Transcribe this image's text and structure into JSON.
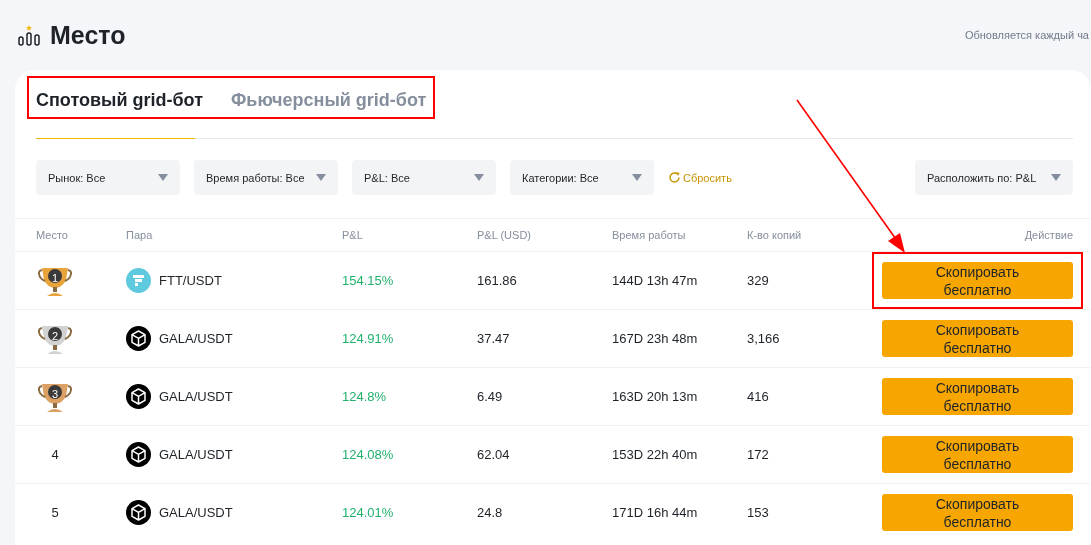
{
  "header": {
    "title": "Место",
    "update_note": "Обновляется каждый ча"
  },
  "tabs_highlighted": true,
  "tabs": [
    {
      "label": "Спотовый grid-бот",
      "selected": true
    },
    {
      "label": "Фьючерсный grid-бот",
      "selected": false
    }
  ],
  "filters": [
    {
      "label": "Рынок: Все"
    },
    {
      "label": "Время работы: Все"
    },
    {
      "label": "P&L: Все"
    },
    {
      "label": "Категории: Все"
    }
  ],
  "reset": "Сбросить",
  "sort": {
    "label": "Расположить по: P&L"
  },
  "table": {
    "columns": [
      "Место",
      "Пара",
      "P&L",
      "P&L (USD)",
      "Время работы",
      "К-во копий",
      "Действие"
    ],
    "rows": [
      {
        "rank": "1",
        "color": "#e8a33a",
        "kind": "ftt",
        "pair": "FTT/USDT",
        "pnl": "154.15%",
        "pnl_usd": "161.86",
        "runtime": "144D 13h 47m",
        "copies": "329",
        "action": "Скопировать бесплатно",
        "highlighted": true
      },
      {
        "rank": "2",
        "color": "#d2d2d2",
        "kind": "gala",
        "pair": "GALA/USDT",
        "pnl": "124.91%",
        "pnl_usd": "37.47",
        "runtime": "167D 23h 48m",
        "copies": "3,166",
        "action": "Скопировать бесплатно",
        "highlighted": false
      },
      {
        "rank": "3",
        "color": "#dca064",
        "kind": "gala",
        "pair": "GALA/USDT",
        "pnl": "124.8%",
        "pnl_usd": "6.49",
        "runtime": "163D 20h 13m",
        "copies": "416",
        "action": "Скопировать бесплатно",
        "highlighted": false
      },
      {
        "rank": "4",
        "kind": "gala",
        "pair": "GALA/USDT",
        "pnl": "124.08%",
        "pnl_usd": "62.04",
        "runtime": "153D 22h 40m",
        "copies": "172",
        "action": "Скопировать бесплатно",
        "highlighted": false
      },
      {
        "rank": "5",
        "kind": "gala",
        "pair": "GALA/USDT",
        "pnl": "124.01%",
        "pnl_usd": "24.8",
        "runtime": "171D 16h 44m",
        "copies": "153",
        "action": "Скопировать бесплатно",
        "highlighted": false
      }
    ]
  },
  "arrow": true
}
